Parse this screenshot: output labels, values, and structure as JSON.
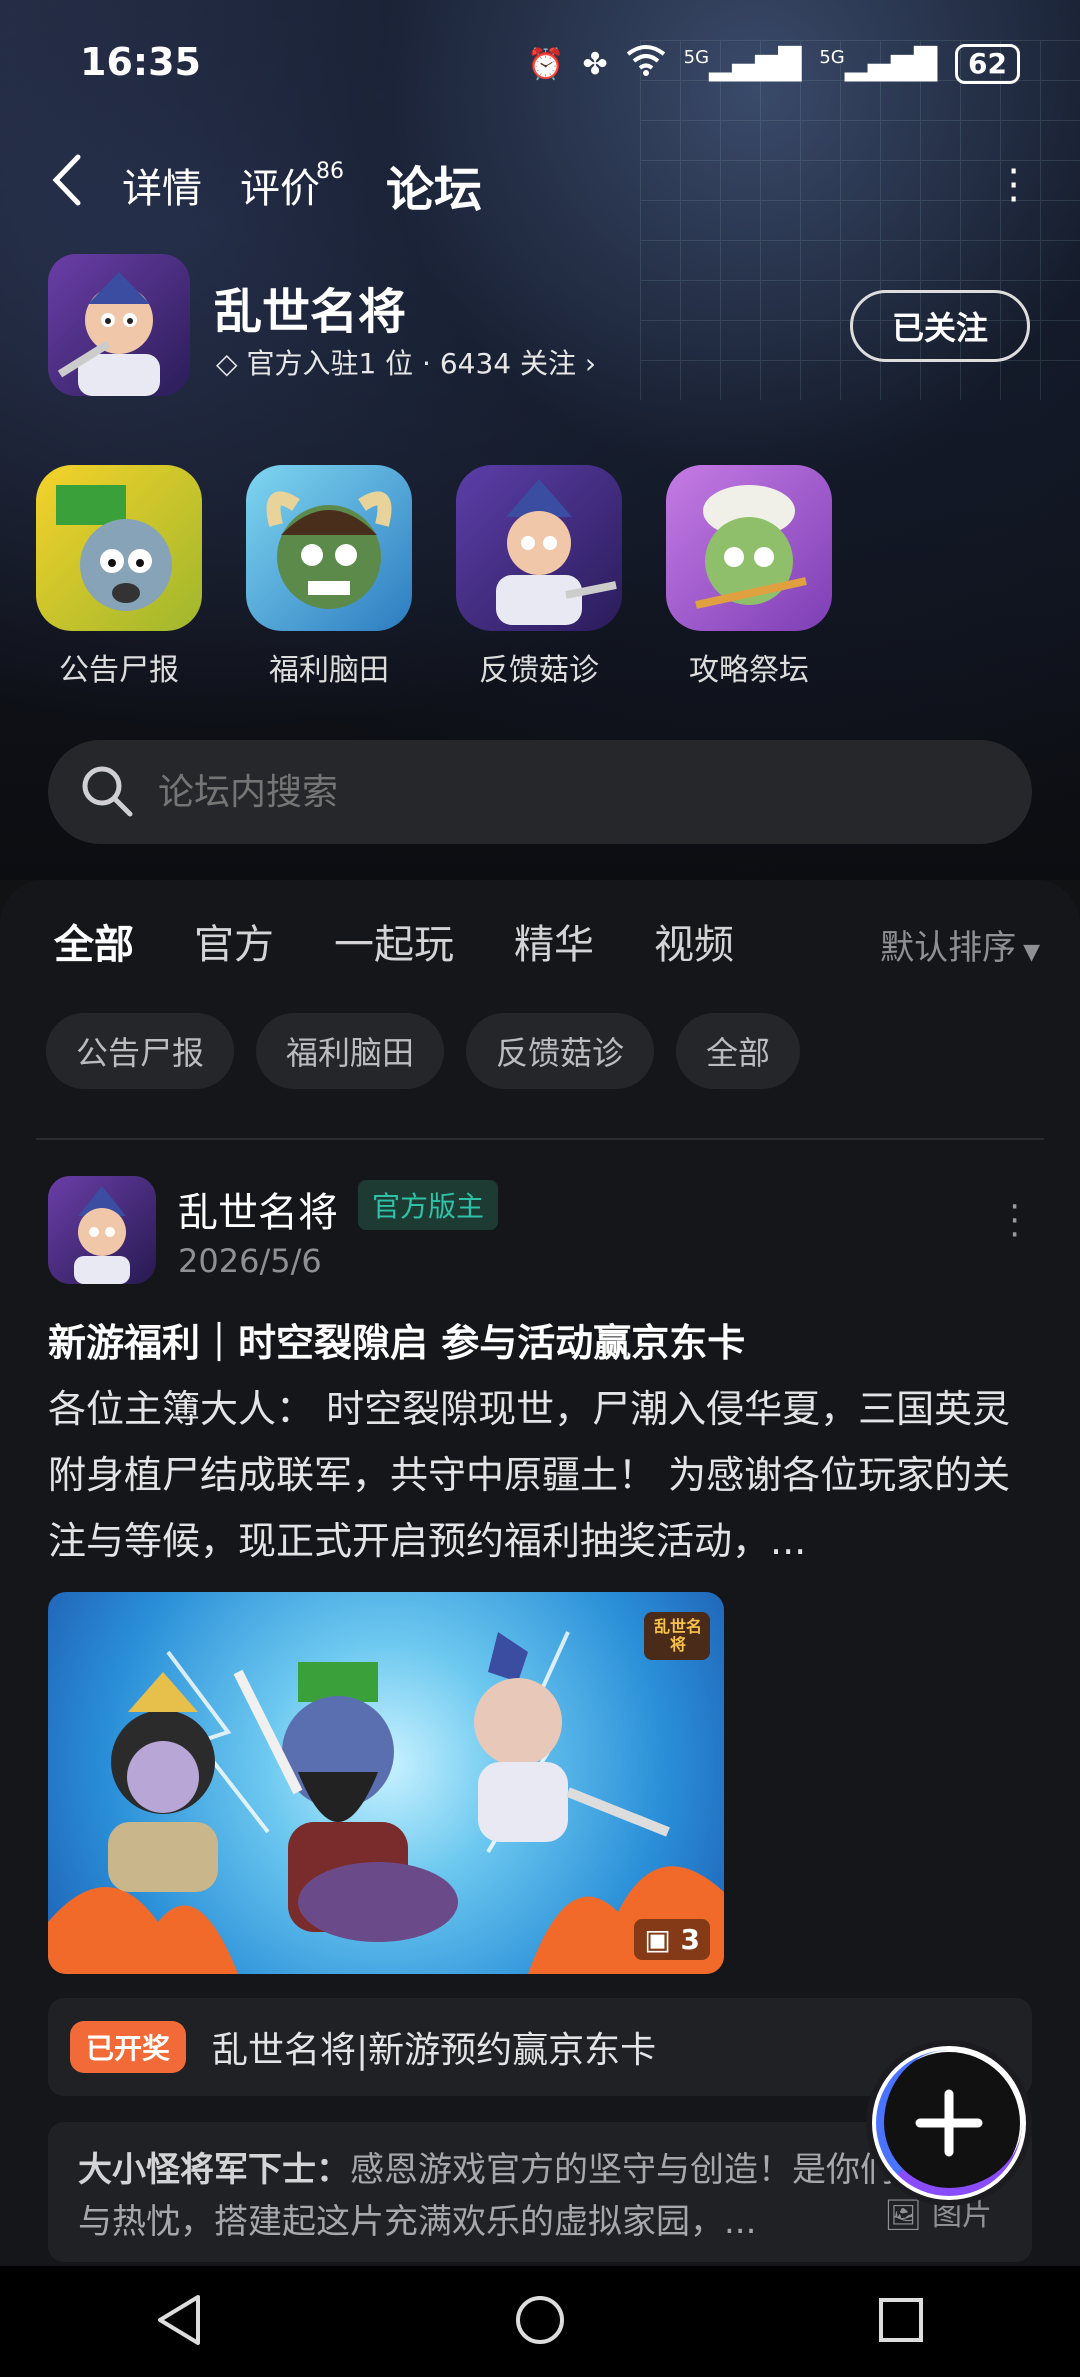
{
  "status_bar": {
    "time": "16:35",
    "signal_1": "5G",
    "signal_2": "5G",
    "battery": "62"
  },
  "nav": {
    "back_label": "<",
    "tabs": [
      {
        "label": "详情"
      },
      {
        "label": "评价",
        "badge": "86"
      },
      {
        "label": "论坛"
      }
    ]
  },
  "game": {
    "title": "乱世名将",
    "subtitle": "官方入驻1 位 · 6434 关注",
    "follow_label": "已关注"
  },
  "categories": [
    {
      "label": "公告尸报"
    },
    {
      "label": "福利脑田"
    },
    {
      "label": "反馈菇诊"
    },
    {
      "label": "攻略祭坛"
    }
  ],
  "search": {
    "placeholder": "论坛内搜索"
  },
  "filter_tabs": [
    {
      "label": "全部"
    },
    {
      "label": "官方"
    },
    {
      "label": "一起玩"
    },
    {
      "label": "精华"
    },
    {
      "label": "视频"
    }
  ],
  "sort_label": "默认排序",
  "chips": [
    {
      "label": "公告尸报"
    },
    {
      "label": "福利脑田"
    },
    {
      "label": "反馈菇诊"
    },
    {
      "label": "全部"
    }
  ],
  "post": {
    "author": "乱世名将",
    "author_tag": "官方版主",
    "date": "2026/5/6",
    "title": "新游福利｜时空裂隙启 参与活动赢京东卡",
    "body": "各位主簿大人： 时空裂隙现世，尸潮入侵华夏，三国英灵附身植尸结成联军，共守中原疆土！ 为感谢各位玩家的关注与等候，现正式开启预约福利抽奖活动，...",
    "image_count": "3",
    "image_logo_text": "乱世名将",
    "lottery_tag": "已开奖",
    "lottery_text": "乱世名将|新游预约赢京东卡",
    "comment_author": "大小怪将军下士：",
    "comment_text": "感恩游戏官方的坚守与创造！是你们的专业与热忱，搭建起这片充满欢乐的虚拟家园，...",
    "comment_pic_label": "图片"
  },
  "colors": {
    "accent": "#2ec3a6",
    "lottery_tag": "#f26a37",
    "background": "#151619"
  }
}
